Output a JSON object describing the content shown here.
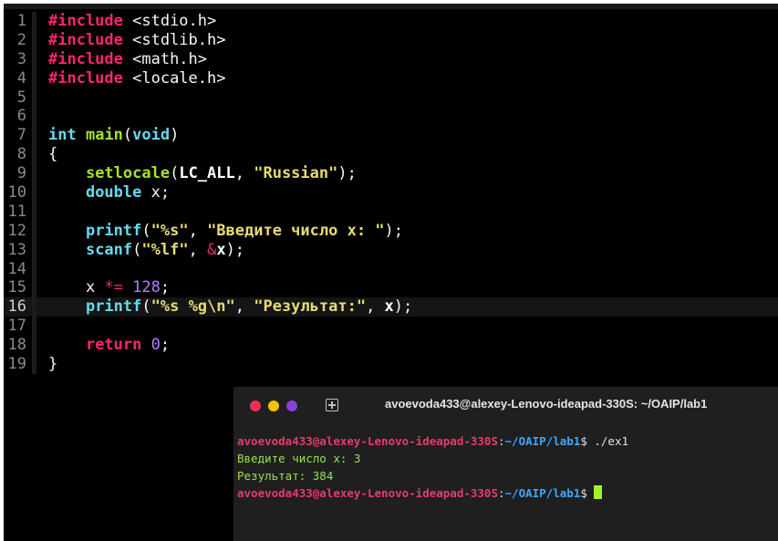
{
  "editor": {
    "lines": [
      {
        "num": "1",
        "segs": [
          {
            "t": "#include",
            "c": "kw"
          },
          {
            "t": " <stdio.h>",
            "c": "inc"
          }
        ]
      },
      {
        "num": "2",
        "segs": [
          {
            "t": "#include",
            "c": "kw"
          },
          {
            "t": " <stdlib.h>",
            "c": "inc"
          }
        ]
      },
      {
        "num": "3",
        "segs": [
          {
            "t": "#include",
            "c": "kw"
          },
          {
            "t": " <math.h>",
            "c": "inc"
          }
        ]
      },
      {
        "num": "4",
        "segs": [
          {
            "t": "#include",
            "c": "kw"
          },
          {
            "t": " <locale.h>",
            "c": "inc"
          }
        ]
      },
      {
        "num": "5",
        "segs": []
      },
      {
        "num": "6",
        "segs": []
      },
      {
        "num": "7",
        "segs": [
          {
            "t": "int",
            "c": "type"
          },
          {
            "t": " ",
            "c": ""
          },
          {
            "t": "main",
            "c": "fn"
          },
          {
            "t": "(",
            "c": ""
          },
          {
            "t": "void",
            "c": "type"
          },
          {
            "t": ")",
            "c": ""
          }
        ]
      },
      {
        "num": "8",
        "segs": [
          {
            "t": "{",
            "c": ""
          }
        ]
      },
      {
        "num": "9",
        "segs": [
          {
            "t": "    ",
            "c": ""
          },
          {
            "t": "setlocale",
            "c": "fn"
          },
          {
            "t": "(",
            "c": ""
          },
          {
            "t": "LC_ALL",
            "c": "bold"
          },
          {
            "t": ", ",
            "c": ""
          },
          {
            "t": "\"Russian\"",
            "c": "str"
          },
          {
            "t": ");",
            "c": ""
          }
        ]
      },
      {
        "num": "10",
        "segs": [
          {
            "t": "    ",
            "c": ""
          },
          {
            "t": "double",
            "c": "type"
          },
          {
            "t": " x;",
            "c": ""
          }
        ]
      },
      {
        "num": "11",
        "segs": []
      },
      {
        "num": "12",
        "segs": [
          {
            "t": "    ",
            "c": ""
          },
          {
            "t": "printf",
            "c": "fnb"
          },
          {
            "t": "(",
            "c": ""
          },
          {
            "t": "\"%s\"",
            "c": "str"
          },
          {
            "t": ", ",
            "c": ""
          },
          {
            "t": "\"Введите число x: \"",
            "c": "str"
          },
          {
            "t": ");",
            "c": ""
          }
        ]
      },
      {
        "num": "13",
        "segs": [
          {
            "t": "    ",
            "c": ""
          },
          {
            "t": "scanf",
            "c": "fnb"
          },
          {
            "t": "(",
            "c": ""
          },
          {
            "t": "\"%lf\"",
            "c": "str"
          },
          {
            "t": ", ",
            "c": ""
          },
          {
            "t": "&",
            "c": "op"
          },
          {
            "t": "x",
            "c": "bold"
          },
          {
            "t": ");",
            "c": ""
          }
        ]
      },
      {
        "num": "14",
        "segs": []
      },
      {
        "num": "15",
        "segs": [
          {
            "t": "    x ",
            "c": ""
          },
          {
            "t": "*=",
            "c": "op"
          },
          {
            "t": " ",
            "c": ""
          },
          {
            "t": "128",
            "c": "num"
          },
          {
            "t": ";",
            "c": ""
          }
        ]
      },
      {
        "num": "16",
        "current": true,
        "segs": [
          {
            "t": "    ",
            "c": ""
          },
          {
            "t": "printf",
            "c": "fnb"
          },
          {
            "t": "(",
            "c": ""
          },
          {
            "t": "\"%s %g\\n\"",
            "c": "str"
          },
          {
            "t": ", ",
            "c": ""
          },
          {
            "t": "\"Результат:\"",
            "c": "str"
          },
          {
            "t": ", ",
            "c": ""
          },
          {
            "t": "x",
            "c": "bold"
          },
          {
            "t": ");",
            "c": ""
          }
        ]
      },
      {
        "num": "17",
        "segs": []
      },
      {
        "num": "18",
        "segs": [
          {
            "t": "    ",
            "c": ""
          },
          {
            "t": "return",
            "c": "kw"
          },
          {
            "t": " ",
            "c": ""
          },
          {
            "t": "0",
            "c": "num"
          },
          {
            "t": ";",
            "c": ""
          }
        ]
      },
      {
        "num": "19",
        "segs": [
          {
            "t": "}",
            "c": ""
          }
        ]
      }
    ]
  },
  "terminal": {
    "title": "avoevoda433@alexey-Lenovo-ideapad-330S: ~/OAIP/lab1",
    "new_tab_icon": "new-tab-icon",
    "lines": [
      {
        "segs": [
          {
            "t": "avoevoda433@alexey-Lenovo-ideapad-330S",
            "c": "tu"
          },
          {
            "t": ":",
            "c": "tw"
          },
          {
            "t": "~/OAIP/lab1",
            "c": "tp"
          },
          {
            "t": "$ ./ex1",
            "c": "tw"
          }
        ]
      },
      {
        "segs": [
          {
            "t": "Введите число x: 3",
            "c": "tg"
          }
        ]
      },
      {
        "segs": [
          {
            "t": "Результат: 384",
            "c": "tg"
          }
        ]
      },
      {
        "segs": [
          {
            "t": "avoevoda433@alexey-Lenovo-ideapad-330S",
            "c": "tu"
          },
          {
            "t": ":",
            "c": "tw"
          },
          {
            "t": "~/OAIP/lab1",
            "c": "tp"
          },
          {
            "t": "$ ",
            "c": "tw"
          }
        ],
        "cursor": true
      }
    ],
    "colors": {
      "close": "#ef2d55",
      "minimize": "#f5c400",
      "maximize": "#8b40d9",
      "cursor": "#a4f22a"
    }
  }
}
